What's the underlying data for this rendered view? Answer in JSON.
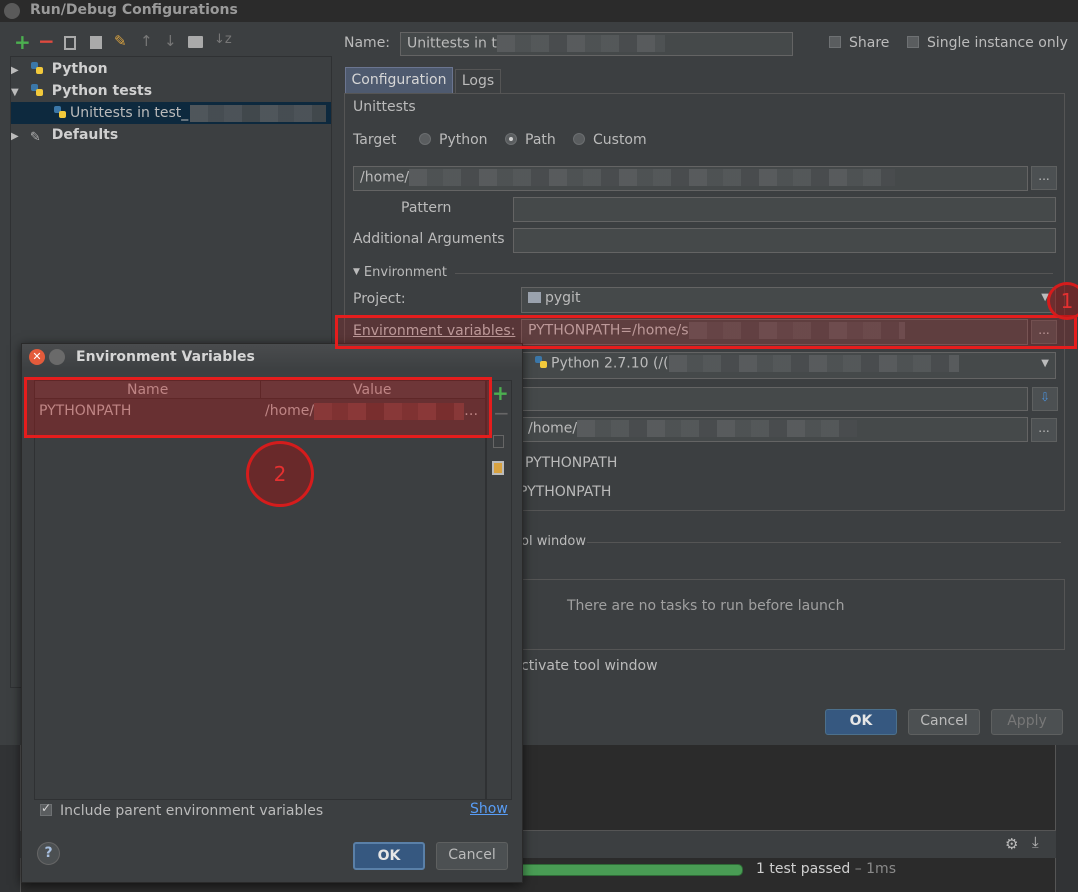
{
  "window": {
    "title": "Run/Debug Configurations"
  },
  "tree": {
    "items": [
      {
        "label": "Python",
        "expanded": false
      },
      {
        "label": "Python tests",
        "expanded": true
      },
      {
        "label": "Unittests in test_",
        "selected": true
      },
      {
        "label": "Defaults",
        "expanded": false
      }
    ]
  },
  "header": {
    "name_label": "Name:",
    "name_value": "Unittests in t",
    "share_label": "Share",
    "single_instance_label": "Single instance only"
  },
  "tabs": [
    {
      "label": "Configuration",
      "active": true
    },
    {
      "label": "Logs",
      "active": false
    }
  ],
  "config": {
    "heading": "Unittests",
    "target_label": "Target",
    "target_options": [
      "Python",
      "Path",
      "Custom"
    ],
    "target_selected": "Path",
    "path_value": "/home/",
    "pattern_label": "Pattern",
    "additional_args_label": "Additional Arguments",
    "environment_section": "Environment",
    "project_label": "Project:",
    "project_value": "pygit",
    "env_vars_label": "Environment variables:",
    "env_vars_value": "PYTHONPATH=/home/s",
    "interpreter_value": "Python 2.7.10 (/(",
    "working_dir_value": "/home/",
    "add_content_roots": "PYTHONPATH",
    "add_source_roots": "PYTHONPATH",
    "tool_window_fragment": "ol window",
    "no_tasks_text": "There are no tasks to run before launch",
    "activate_fragment": "ctivate tool window"
  },
  "main_buttons": {
    "ok": "OK",
    "cancel": "Cancel",
    "apply": "Apply"
  },
  "background": {
    "test_status": "1 test passed",
    "test_time": " – 1ms"
  },
  "env_dialog": {
    "title": "Environment Variables",
    "columns": [
      "Name",
      "Value"
    ],
    "rows": [
      {
        "name": "PYTHONPATH",
        "value": "/home/"
      }
    ],
    "include_parent_label": "Include parent environment variables",
    "include_parent_checked": true,
    "show_link": "Show",
    "ok": "OK",
    "cancel": "Cancel",
    "help": "?"
  },
  "annotations": {
    "one": "1",
    "two": "2"
  },
  "colors": {
    "background": "#3c3f41",
    "accent": "#365880",
    "annotation": "#e51d1d",
    "selection": "#0d293e",
    "add_green": "#4caf50",
    "remove_red": "#e04a3f"
  }
}
